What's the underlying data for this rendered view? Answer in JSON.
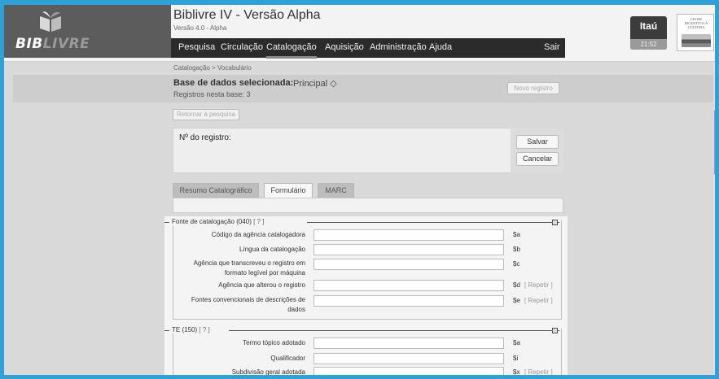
{
  "header": {
    "logo_text_bib": "BIB",
    "logo_text_livre": "LIVRE",
    "title": "Biblivre IV - Versão Alpha",
    "version": "Versão 4.0 - Alpha"
  },
  "menu": {
    "items": [
      "Pesquisa",
      "Circulação",
      "Catalogação",
      "Aquisição",
      "Administração",
      "Ajuda"
    ],
    "active": "Catalogação",
    "logout": "Sair"
  },
  "sponsors": {
    "itau": "Itaú",
    "time": "21:52",
    "lei": "LEI DE INCENTIVO À CULTURA"
  },
  "breadcrumb": "Catalogação > Vocabulário",
  "database": {
    "label": "Base de dados selecionada:",
    "value": "Principal ◇",
    "count": "Registros nesta base: 3",
    "new_record": "Novo registro"
  },
  "back_button": "Retornar à pesquisa",
  "record": {
    "label": "Nº do registro:",
    "save": "Salvar",
    "cancel": "Cancelar"
  },
  "tabs": [
    {
      "label": "Resumo Catalográfico",
      "active": false
    },
    {
      "label": "Formulário",
      "active": true
    },
    {
      "label": "MARC",
      "active": false
    }
  ],
  "sections": [
    {
      "legend": "Fonte de catalogação",
      "code": "(040)",
      "help": "[ ? ]",
      "rows": [
        {
          "label": "Código da agência catalogadora",
          "sub": "$a",
          "repeat": ""
        },
        {
          "label": "Língua da catalogação",
          "sub": "$b",
          "repeat": ""
        },
        {
          "label": "Agência que transcreveu o registro em formato legível por máquina",
          "sub": "$c",
          "repeat": ""
        },
        {
          "label": "Agência que alterou o registro",
          "sub": "$d",
          "repeat": "[ Repetir ]"
        },
        {
          "label": "Fontes convencionais de descrições de dados",
          "sub": "$e",
          "repeat": "[ Repetir ]"
        }
      ]
    },
    {
      "legend": "TE",
      "code": "(150)",
      "help": "[ ? ]",
      "rows": [
        {
          "label": "Termo tópico adotado",
          "sub": "$a",
          "repeat": ""
        },
        {
          "label": "Qualificador",
          "sub": "$i",
          "repeat": ""
        },
        {
          "label": "Subdivisão geral adotada",
          "sub": "$x",
          "repeat": "[ Repetir ]"
        }
      ]
    }
  ]
}
